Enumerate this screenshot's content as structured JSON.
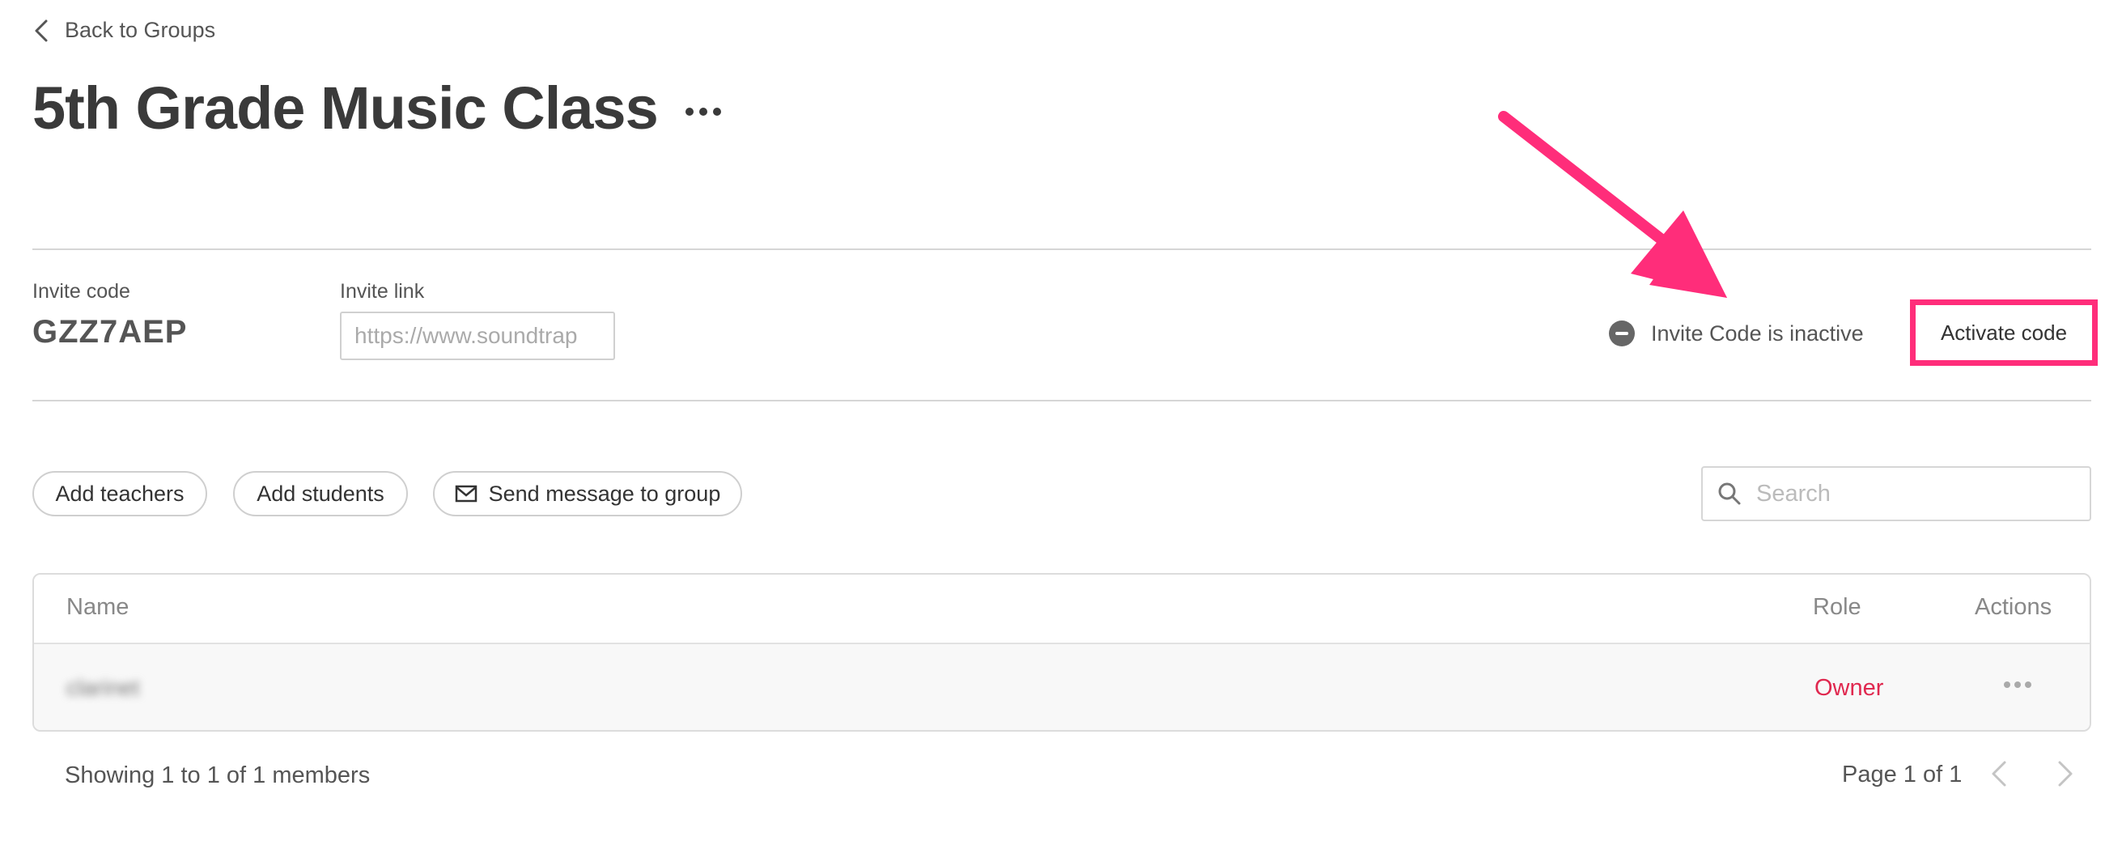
{
  "nav": {
    "back_label": "Back to Groups"
  },
  "group": {
    "title": "5th Grade Music Class"
  },
  "invite": {
    "code_label": "Invite code",
    "code_value": "GZZ7AEP",
    "link_label": "Invite link",
    "link_placeholder": "https://www.soundtrap",
    "status_text": "Invite Code is inactive",
    "activate_label": "Activate code"
  },
  "actions": {
    "add_teachers": "Add teachers",
    "add_students": "Add students",
    "send_message": "Send message to group"
  },
  "search": {
    "placeholder": "Search"
  },
  "table": {
    "columns": {
      "name": "Name",
      "role": "Role",
      "actions": "Actions"
    },
    "rows": [
      {
        "name": "clarinet",
        "role": "Owner"
      }
    ]
  },
  "footer": {
    "showing": "Showing 1 to 1 of 1 members",
    "page_info": "Page 1 of 1"
  },
  "colors": {
    "accent_highlight": "#ff2d7a",
    "role_owner": "#e0284f",
    "title_text": "#3a3a3a"
  },
  "icons": {
    "back": "chevron-left-icon",
    "more": "more-horizontal-icon",
    "status": "minus-circle-icon",
    "mail": "mail-icon",
    "search": "search-icon",
    "prev": "chevron-left-icon",
    "next": "chevron-right-icon"
  }
}
